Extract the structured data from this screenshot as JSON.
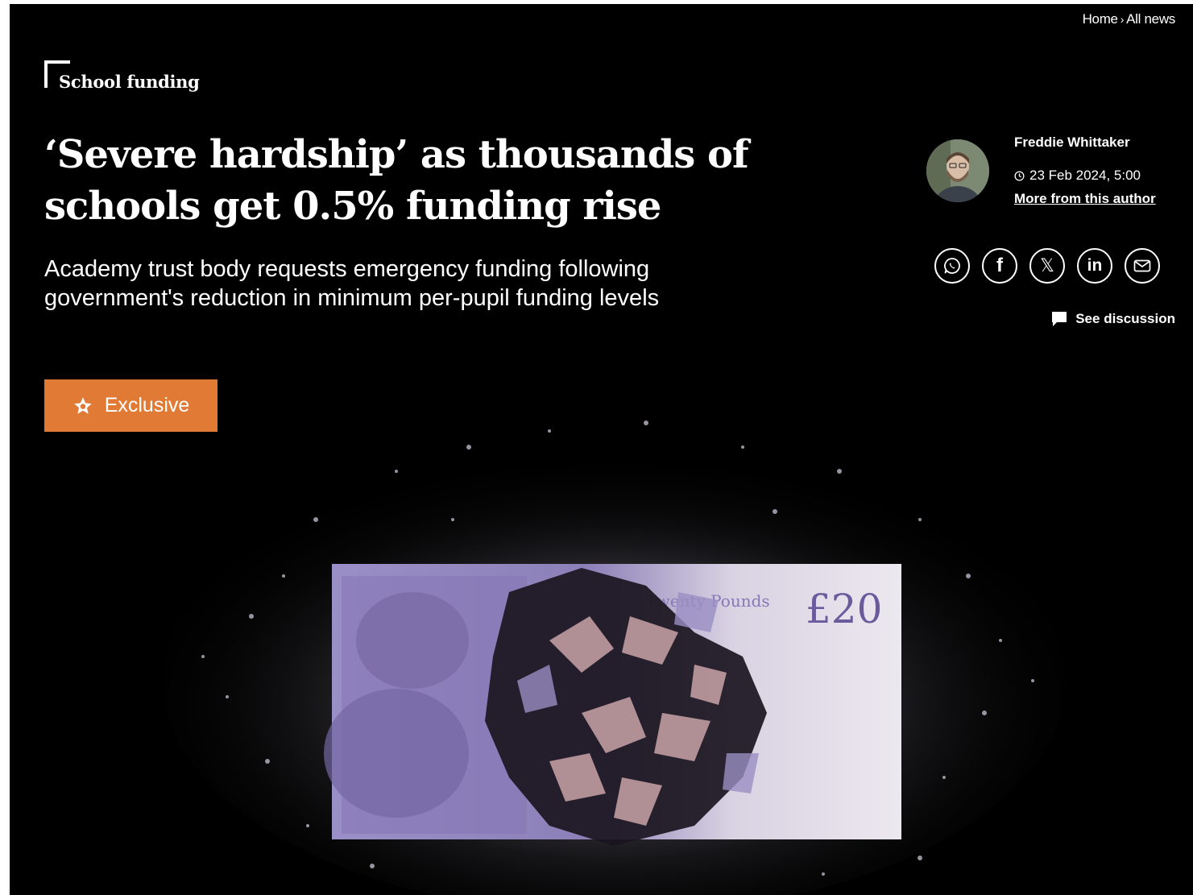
{
  "breadcrumb": {
    "home": "Home",
    "separator": "›",
    "current": "All news"
  },
  "category": "School funding",
  "headline": "‘Severe hardship’ as thousands of schools get 0.5% funding rise",
  "standfirst": "Academy trust body requests emergency funding following government's reduction in minimum per-pupil funding levels",
  "author": {
    "name": "Freddie Whittaker",
    "date": "23 Feb 2024, 5:00",
    "more_link": "More from this author"
  },
  "share": {
    "icons": [
      "whatsapp-icon",
      "facebook-icon",
      "x-icon",
      "linkedin-icon",
      "email-icon"
    ],
    "x_glyph": "𝕏",
    "facebook_glyph": "f",
    "linkedin_glyph": "in"
  },
  "discussion": "See discussion",
  "badge": {
    "label": "Exclusive",
    "color": "#e07a35"
  },
  "hero": {
    "banknote_value": "£20",
    "banknote_text": "Twenty Pounds"
  }
}
